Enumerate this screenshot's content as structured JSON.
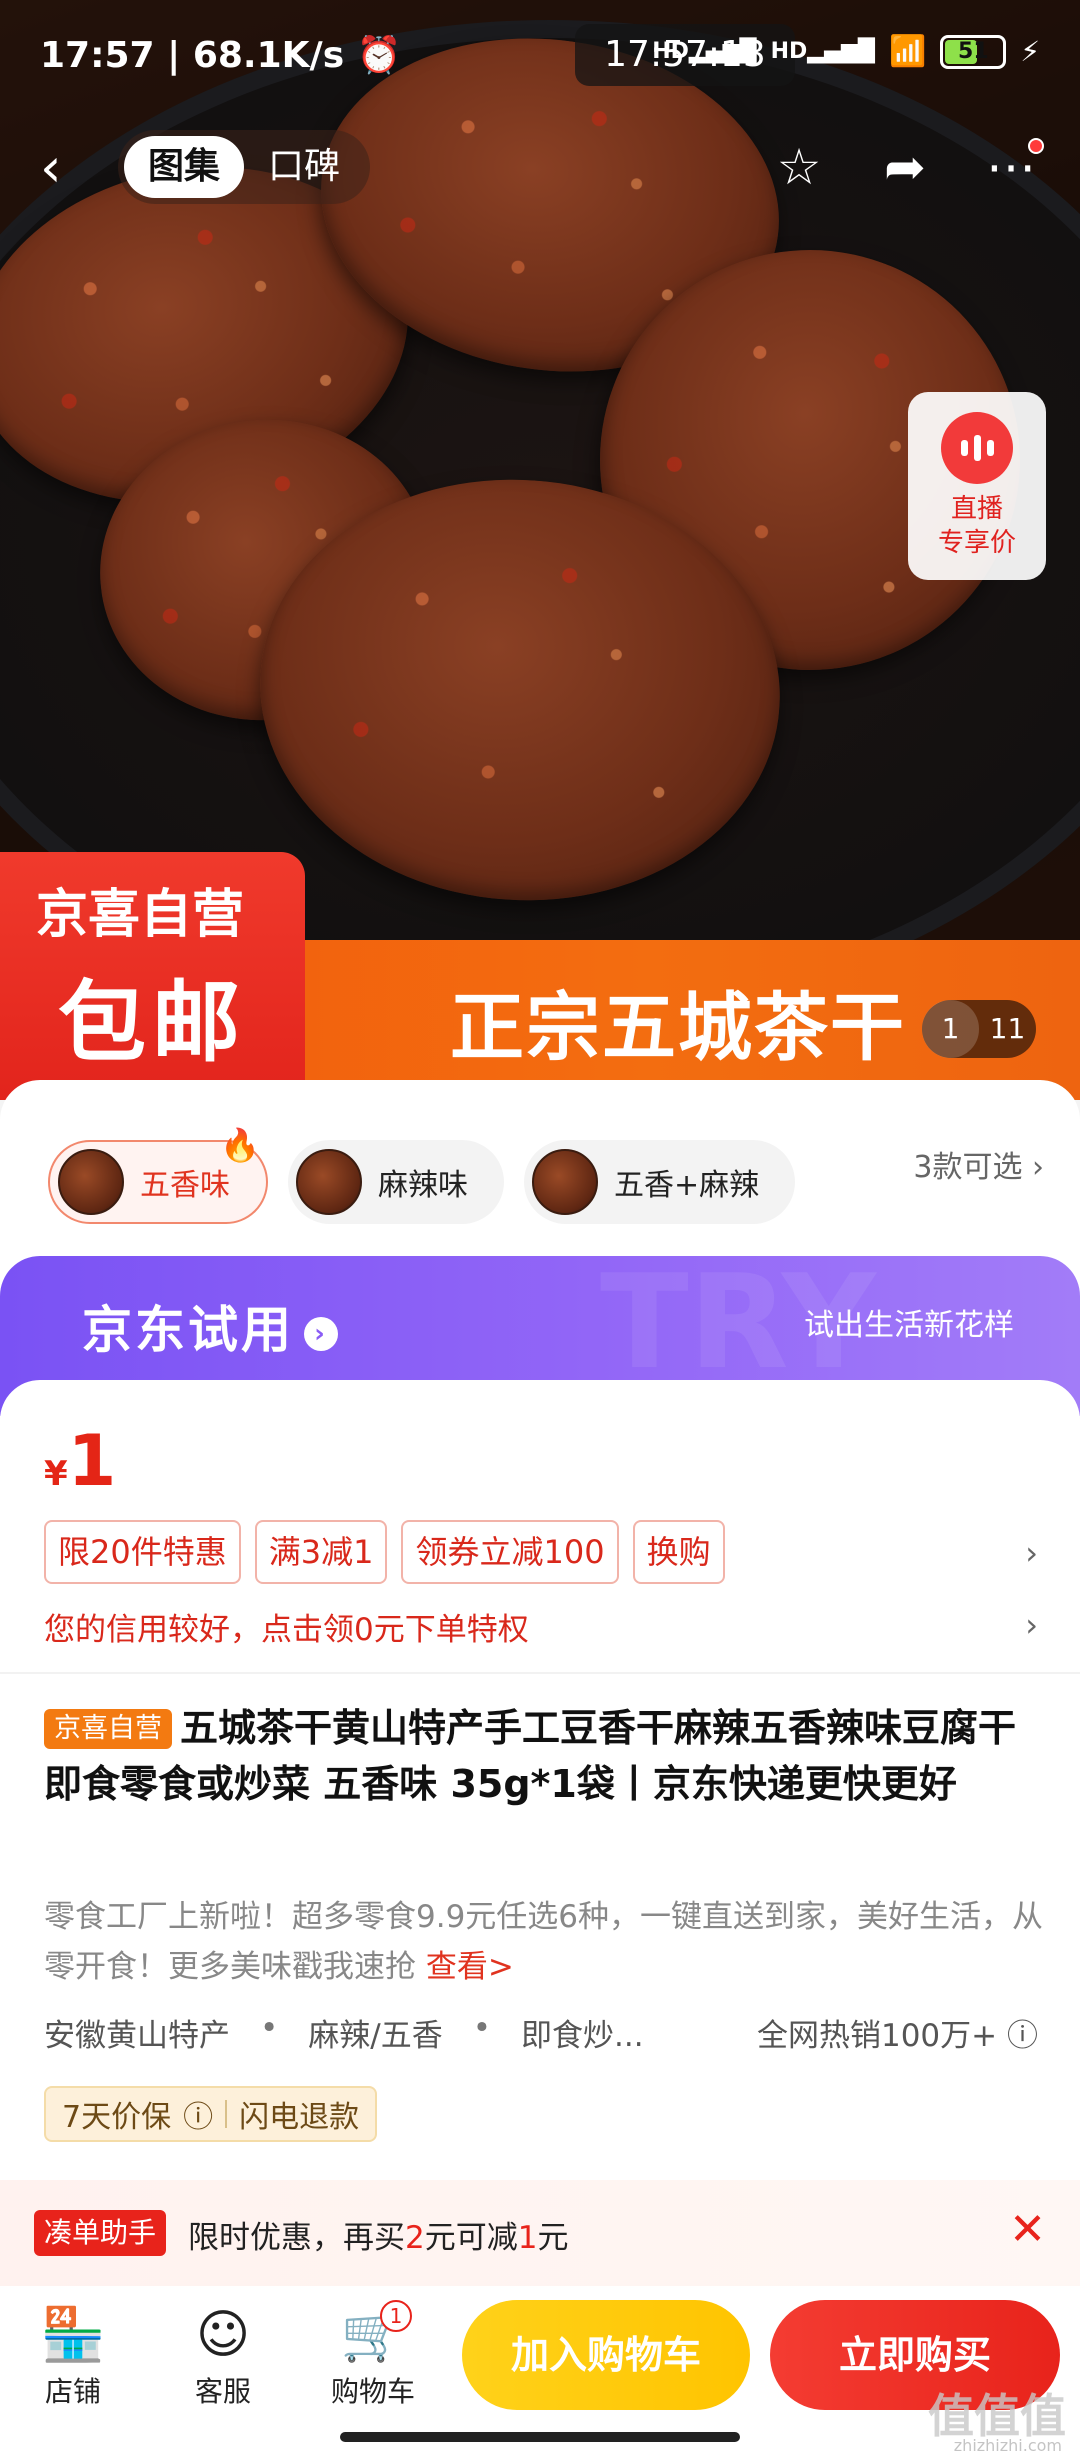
{
  "status": {
    "time": "17:57",
    "speed": "68.1K/s",
    "clock": "17:57:13",
    "net1": "HD",
    "net2": "HD",
    "battery": "51"
  },
  "nav": {
    "tabs": [
      "图集",
      "口碑"
    ],
    "active_tab": 0
  },
  "live": {
    "line1": "直播",
    "line2": "专享价"
  },
  "banner": {
    "badge_top": "京喜自营",
    "badge_main": "包邮",
    "title": "正宗五城茶干",
    "page_current": "1",
    "page_total": "11"
  },
  "variants": {
    "items": [
      {
        "label": "五香味",
        "selected": true
      },
      {
        "label": "麻辣味",
        "selected": false
      },
      {
        "label": "五香+麻辣",
        "selected": false
      }
    ],
    "more": "3款可选"
  },
  "trial": {
    "title": "京东试用",
    "subtitle": "试出生活新花样",
    "watermark": "TRY"
  },
  "price": {
    "currency": "¥",
    "value": "1"
  },
  "promos": [
    "限20件特惠",
    "满3减1",
    "领券立减100",
    "换购"
  ],
  "credit": "您的信用较好，点击领0元下单特权",
  "product": {
    "tag": "京喜自营",
    "title": "五城茶干黄山特产手工豆香干麻辣五香辣味豆腐干即食零食或炒菜 五香味 35g*1袋丨京东快递更快更好",
    "desc": "零食工厂上新啦！超多零食9.9元任选6种，一键直送到家，美好生活，从零开食！更多美味戳我速抢",
    "desc_link": "查看>",
    "attrs": [
      "安徽黄山特产",
      "麻辣/五香",
      "即食炒..."
    ],
    "hot": "全网热销100万+",
    "guarantees": [
      "7天价保",
      "闪电退款"
    ]
  },
  "assist": {
    "tag": "凑单助手",
    "text_a": "限时优惠，再买",
    "amount": "2",
    "text_b": "元可减",
    "discount": "1",
    "text_c": "元"
  },
  "bottom": {
    "shop": "店铺",
    "service": "客服",
    "cart": "购物车",
    "cart_count": "1",
    "add_cart": "加入购物车",
    "buy_now": "立即购买"
  },
  "watermark": {
    "logo": "值值值",
    "url": "zhizhizhi.com"
  }
}
